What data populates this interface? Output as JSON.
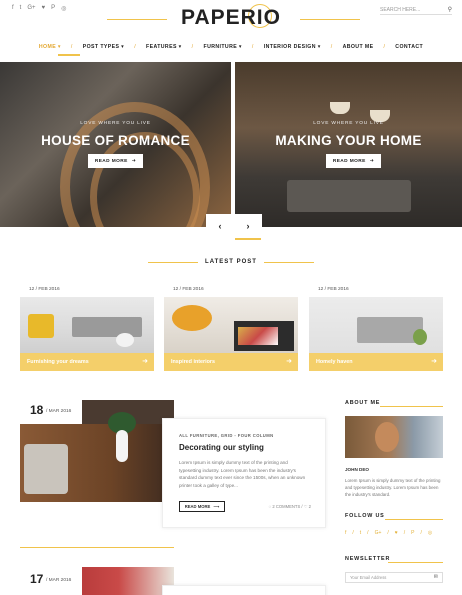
{
  "header": {
    "logo": "PAPERIO",
    "social_icons": [
      "f",
      "t",
      "G+",
      "♥",
      "P",
      "◎"
    ],
    "search_placeholder": "SEARCH HERE...",
    "search_icon": "⚲"
  },
  "nav": {
    "items": [
      {
        "label": "HOME ▾",
        "active": true
      },
      {
        "label": "POST TYPES ▾"
      },
      {
        "label": "FEATURES ▾"
      },
      {
        "label": "FURNITURE ▾"
      },
      {
        "label": "INTERIOR DESIGN ▾"
      },
      {
        "label": "ABOUT ME"
      },
      {
        "label": "CONTACT"
      }
    ],
    "separator": "/"
  },
  "slider": {
    "slides": [
      {
        "kicker": "LOVE WHERE YOU LIVE",
        "title": "HOUSE OF ROMANCE",
        "button": "READ MORE"
      },
      {
        "kicker": "LOVE WHERE YOU LIVE",
        "title": "MAKING YOUR HOME",
        "button": "READ MORE"
      }
    ],
    "button_arrow": "➜",
    "prev": "‹",
    "next": "›"
  },
  "latest": {
    "title": "LATEST POST",
    "cards": [
      {
        "date": "12 / FEB 2016",
        "label": "Furnishing your dreams"
      },
      {
        "date": "12 / FEB 2016",
        "label": "Inspired interiors"
      },
      {
        "date": "12 / FEB 2016",
        "label": "Homely haven"
      }
    ],
    "arrow": "➜"
  },
  "featured": {
    "day": "18",
    "month": "/ MAR 2016",
    "category": "ALL FURNITURE, GRID - FOUR COLUMN",
    "title": "Decorating our styling",
    "text": "Lorem Ipsum is simply dummy text of the printing and typesetting industry. Lorem Ipsum has been the industry's standard dummy text ever since the 1500s, when an unknown printer took a galley of type...",
    "button": "READ MORE",
    "button_arrow": "⟶",
    "comments": "◌ 2 COMMENTS",
    "likes": "/ ♡ 2"
  },
  "second_post": {
    "day": "17",
    "month": "/ MAR 2016"
  },
  "sidebar": {
    "about_title": "ABOUT ME",
    "about_name": "JOHN DEO",
    "about_text": "Lorem Ipsum is simply dummy text of the printing and typesetting industry. Lorem Ipsum has been the industry's standard.",
    "follow_title": "FOLLOW US",
    "follow_icons": [
      "f",
      "/",
      "t",
      "/",
      "G+",
      "/",
      "♥",
      "/",
      "P",
      "/",
      "◎"
    ],
    "newsletter_title": "NEWSLETTER",
    "newsletter_placeholder": "Your Email Address",
    "newsletter_icon": "✉"
  },
  "colors": {
    "accent": "#f0c34b",
    "card_bar": "#f4cf6a",
    "active_nav": "#e3a72f"
  }
}
